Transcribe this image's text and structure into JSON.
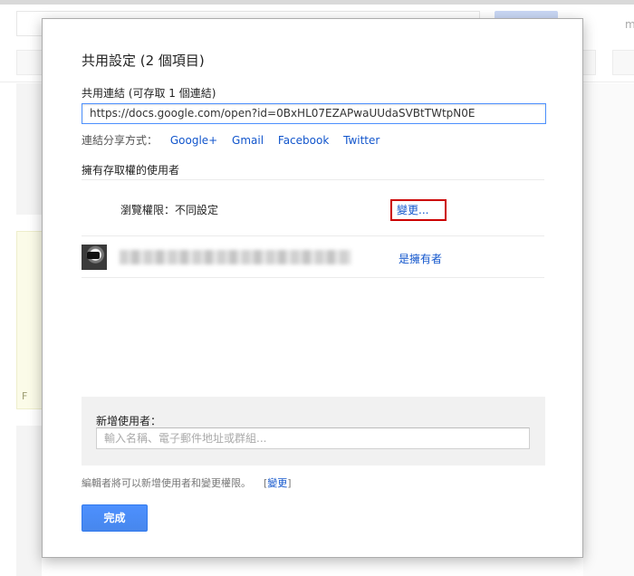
{
  "background": {
    "corner_char": "m",
    "card_label": "F"
  },
  "dialog": {
    "title": "共用設定 (2 個項目)",
    "link_section": {
      "label": "共用連結 (可存取 1 個連結)",
      "url": "https://docs.google.com/open?id=0BxHL07EZAPwaUUdaSVBtTWtpN0E",
      "share_label": "連結分享方式：",
      "share_targets": [
        "Google+",
        "Gmail",
        "Facebook",
        "Twitter"
      ]
    },
    "access": {
      "header": "擁有存取權的使用者",
      "permission_label": "瀏覽權限：不同設定",
      "change_link": "變更...",
      "owner_role": "是擁有者"
    },
    "add_user": {
      "label": "新增使用者：",
      "placeholder": "輸入名稱、電子郵件地址或群組..."
    },
    "footnote": {
      "text": "編輯者將可以新增使用者和變更權限。",
      "bracket_open": "[",
      "link": "變更",
      "bracket_close": "]"
    },
    "done_button": "完成"
  },
  "colors": {
    "accent": "#4d90fe",
    "link": "#1155cc",
    "highlight_border": "#cc0000",
    "panel_bg": "#f1f1f1"
  },
  "icons": {
    "avatar": "user-avatar-icon"
  }
}
